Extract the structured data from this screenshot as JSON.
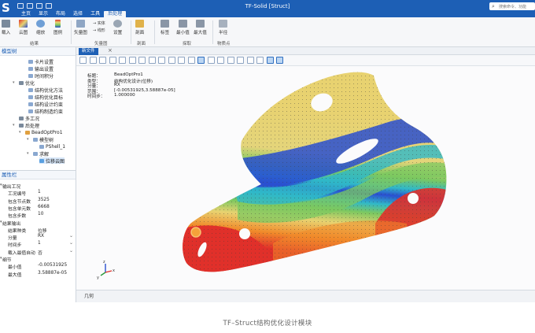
{
  "app": {
    "logo": "S",
    "window_title": "TF-Solid [Struct]",
    "search_placeholder": "搜索命令、功能",
    "tabs": [
      "主页",
      "显示",
      "布局",
      "选择",
      "工具",
      "后处理"
    ],
    "active_tab_index": 5
  },
  "ribbon": {
    "buttons": {
      "load": "载入",
      "cloud": "云图",
      "scale": "缩放",
      "legend": "图例",
      "vector": "矢量图",
      "settings": "设置",
      "section": "剖面",
      "label": "标签",
      "min": "最小值",
      "max": "最大值",
      "radius": "半径"
    },
    "small": {
      "solid": "实体",
      "line": "线形"
    },
    "groups": {
      "result": "结果",
      "vector_group": "矢量图",
      "section_group": "剖面",
      "probe": "探取",
      "physics": "物质点"
    }
  },
  "tree": {
    "title": "模型树",
    "items": [
      {
        "label": "卡片设置"
      },
      {
        "label": "输出设置"
      },
      {
        "label": "时间积分"
      },
      {
        "label": "优化"
      },
      {
        "label": "结构优化方法"
      },
      {
        "label": "结构优化目标"
      },
      {
        "label": "结构设计约束"
      },
      {
        "label": "结构制造约束"
      },
      {
        "label": "多工况"
      },
      {
        "label": "后处理"
      },
      {
        "label": "BeadOptPro1"
      },
      {
        "label": "模型树"
      },
      {
        "label": "PShell_1"
      },
      {
        "label": "求解"
      },
      {
        "label": "位移云图"
      }
    ]
  },
  "properties": {
    "title": "属性栏",
    "rows": [
      {
        "key": "输出工况",
        "value": "",
        "group": true,
        "dropdown": false
      },
      {
        "key": "工况编号",
        "value": "1",
        "group": false,
        "dropdown": false
      },
      {
        "key": "包含节点数",
        "value": "3525",
        "group": false,
        "dropdown": false
      },
      {
        "key": "包含单元数",
        "value": "6668",
        "group": false,
        "dropdown": false
      },
      {
        "key": "包含步数",
        "value": "10",
        "group": false,
        "dropdown": false
      },
      {
        "key": "结果输出",
        "value": "",
        "group": true,
        "dropdown": false
      },
      {
        "key": "结果种类",
        "value": "位移",
        "group": false,
        "dropdown": false
      },
      {
        "key": "分量",
        "value": "RX",
        "group": false,
        "dropdown": true
      },
      {
        "key": "时间步",
        "value": "1",
        "group": false,
        "dropdown": true
      },
      {
        "key": "载入最值自动",
        "value": "否",
        "group": false,
        "dropdown": true
      },
      {
        "key": "细节",
        "value": "",
        "group": true,
        "dropdown": false
      },
      {
        "key": "最小值",
        "value": "-0.00531925",
        "group": false,
        "dropdown": false
      },
      {
        "key": "最大值",
        "value": "3.58887e-05",
        "group": false,
        "dropdown": false
      }
    ]
  },
  "viewport": {
    "tab_label": "新文件",
    "bottom_tab": "几何",
    "info": [
      {
        "key": "标题：",
        "value": "BeadOptPro1"
      },
      {
        "key": "类型：",
        "value": "结构优化设计(位移)"
      },
      {
        "key": "分量：",
        "value": "RX"
      },
      {
        "key": "范围：",
        "value": "[-0.00531925,3.58887e-05]"
      },
      {
        "key": "时间步：",
        "value": "1.000000"
      }
    ],
    "axis_labels": {
      "x": "x",
      "y": "y",
      "z": "z"
    },
    "colors": {
      "accent": "#1d5fb5",
      "red": "#e0302a",
      "orange": "#f08a2a",
      "yellow": "#e8d270",
      "green": "#7cc860",
      "cyan": "#30b8c8",
      "blue": "#2a4fd0"
    }
  },
  "caption": "TF–Struct结构优化设计模块"
}
